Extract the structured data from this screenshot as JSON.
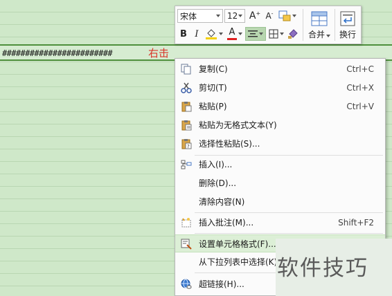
{
  "sheet": {
    "cell_text": "########################",
    "annotation": "右击"
  },
  "mini_toolbar": {
    "font_name": "宋体",
    "font_size": "12",
    "bold": "B",
    "italic": "I",
    "font_color_letter": "A",
    "grow_font": "A",
    "shrink_font": "A",
    "merge_label": "合并",
    "wrap_label": "换行"
  },
  "context_menu": {
    "items": [
      {
        "label": "复制(C)",
        "shortcut": "Ctrl+C",
        "icon": "copy-icon"
      },
      {
        "label": "剪切(T)",
        "shortcut": "Ctrl+X",
        "icon": "scissors-icon"
      },
      {
        "label": "粘贴(P)",
        "shortcut": "Ctrl+V",
        "icon": "paste-icon"
      },
      {
        "label": "粘贴为无格式文本(Y)",
        "shortcut": "",
        "icon": "paste-text-icon"
      },
      {
        "label": "选择性粘贴(S)...",
        "shortcut": "",
        "icon": "paste-special-icon"
      },
      {
        "label": "插入(I)...",
        "shortcut": "",
        "icon": "insert-icon"
      },
      {
        "label": "删除(D)...",
        "shortcut": "",
        "icon": ""
      },
      {
        "label": "清除内容(N)",
        "shortcut": "",
        "icon": ""
      },
      {
        "label": "插入批注(M)...",
        "shortcut": "Shift+F2",
        "icon": "comment-icon"
      },
      {
        "label": "设置单元格格式(F)...",
        "shortcut": "",
        "icon": "format-cells-icon"
      },
      {
        "label": "从下拉列表中选择(K)",
        "shortcut": "",
        "icon": ""
      },
      {
        "label": "超链接(H)...",
        "shortcut": "",
        "icon": "hyperlink-icon"
      }
    ]
  },
  "watermark": "软件技巧",
  "colors": {
    "highlight": "#dcefd6",
    "annotation": "#d9362a",
    "font_color_bar": "#e02020",
    "fill_color_bar": "#f5d000"
  }
}
